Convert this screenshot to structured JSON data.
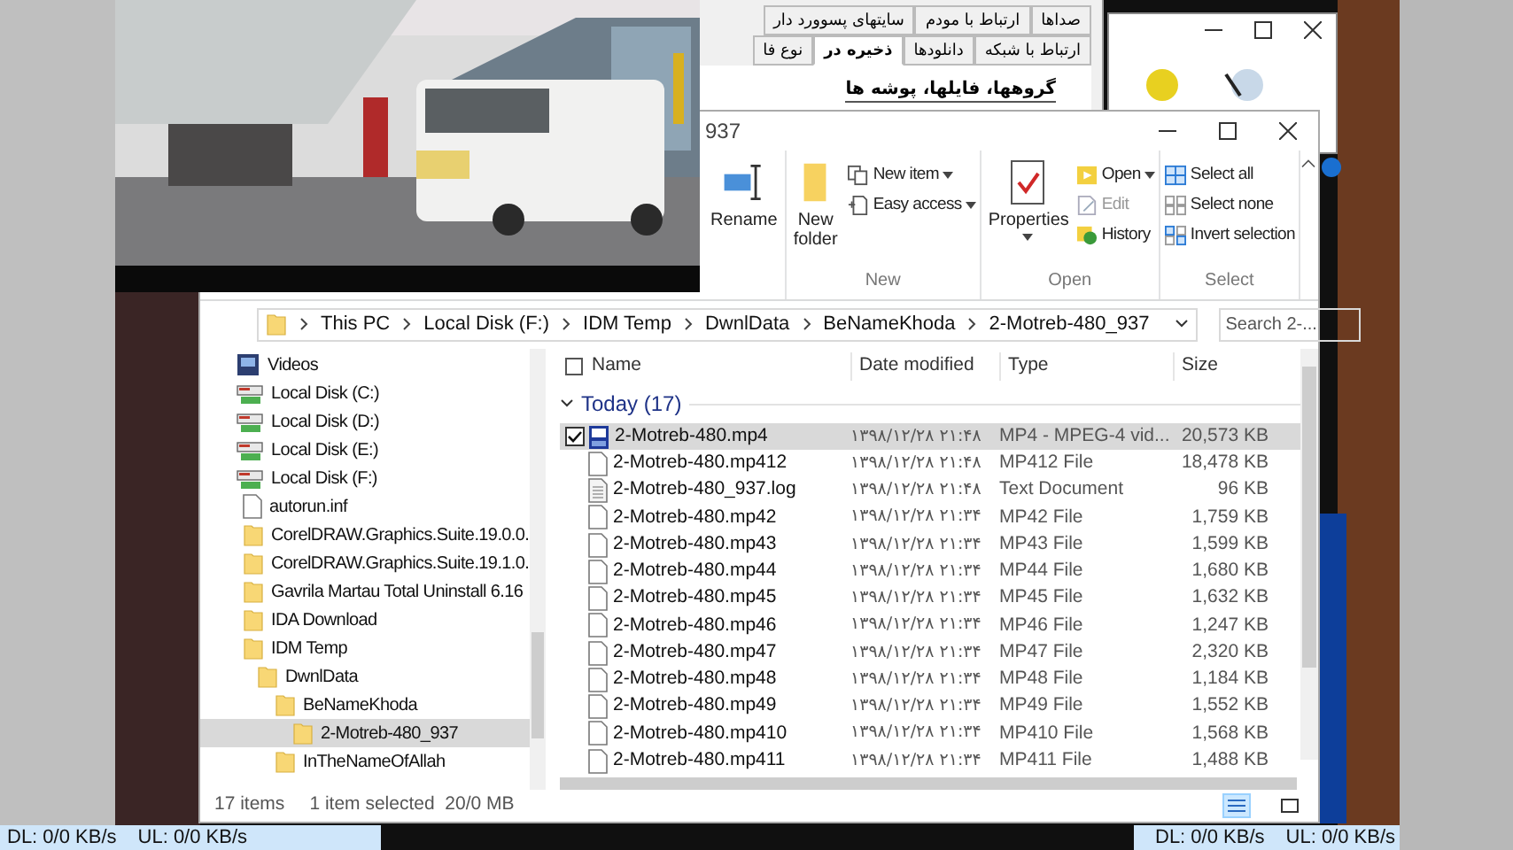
{
  "back_dialog": {
    "tabs_top": [
      {
        "label": "صداها",
        "selected": false
      },
      {
        "label": "ارتباط با مودم",
        "selected": false
      },
      {
        "label": "سایتهای پسوورد دار",
        "selected": false
      }
    ],
    "tabs_bottom": [
      {
        "label": "ارتباط با شبکه",
        "selected": false
      },
      {
        "label": "دانلودها",
        "selected": false
      },
      {
        "label": "ذخیره در",
        "selected": true
      },
      {
        "label": "نوع فا",
        "selected": false
      }
    ],
    "heading": "گروهها، فایلها، پوشه ها"
  },
  "explorer": {
    "title": "937",
    "ribbon": {
      "groups": [
        {
          "items": [
            {
              "label": "Rename",
              "kind": "large"
            }
          ]
        },
        {
          "label": "New",
          "items": [
            {
              "label": "New folder",
              "kind": "large"
            },
            {
              "label": "New item",
              "kind": "small",
              "dropdown": true
            },
            {
              "label": "Easy access",
              "kind": "small",
              "dropdown": true
            }
          ]
        },
        {
          "label": "Open",
          "items": [
            {
              "label": "Properties",
              "kind": "large",
              "dropdown": true
            },
            {
              "label": "Open",
              "kind": "small",
              "dropdown": true
            },
            {
              "label": "Edit",
              "kind": "small",
              "disabled": true
            },
            {
              "label": "History",
              "kind": "small"
            }
          ]
        },
        {
          "label": "Select",
          "items": [
            {
              "label": "Select all",
              "kind": "small"
            },
            {
              "label": "Select none",
              "kind": "small"
            },
            {
              "label": "Invert selection",
              "kind": "small"
            }
          ]
        }
      ]
    },
    "breadcrumb": [
      "This PC",
      "Local Disk (F:)",
      "IDM Temp",
      "DwnlData",
      "BeNameKhoda",
      "2-Motreb-480_937"
    ],
    "search": {
      "placeholder": "Search 2-..."
    },
    "nav": [
      {
        "label": "Videos",
        "kind": "videos",
        "selected": false
      },
      {
        "label": "Local Disk (C:)",
        "kind": "drive",
        "selected": false
      },
      {
        "label": "Local Disk (D:)",
        "kind": "drive",
        "selected": false
      },
      {
        "label": "Local Disk (E:)",
        "kind": "drive",
        "selected": false
      },
      {
        "label": "Local Disk (F:)",
        "kind": "drive",
        "selected": false,
        "children": [
          {
            "label": "autorun.inf",
            "kind": "file",
            "selected": false
          },
          {
            "label": "CorelDRAW.Graphics.Suite.19.0.0.",
            "kind": "folder",
            "selected": false
          },
          {
            "label": "CorelDRAW.Graphics.Suite.19.1.0.",
            "kind": "folder",
            "selected": false
          },
          {
            "label": "Gavrila Martau Total Uninstall 6.16",
            "kind": "folder",
            "selected": false
          },
          {
            "label": "IDA Download",
            "kind": "folder",
            "selected": false
          },
          {
            "label": "IDM Temp",
            "kind": "folder",
            "selected": false,
            "children": [
              {
                "label": "DwnlData",
                "kind": "folder",
                "selected": false,
                "children": [
                  {
                    "label": "BeNameKhoda",
                    "kind": "folder",
                    "selected": false,
                    "children": [
                      {
                        "label": "2-Motreb-480_937",
                        "kind": "folder",
                        "selected": true
                      }
                    ]
                  },
                  {
                    "label": "InTheNameOfAllah",
                    "kind": "folder",
                    "selected": false
                  }
                ]
              }
            ]
          }
        ]
      }
    ],
    "columns": [
      "Name",
      "Date modified",
      "Type",
      "Size"
    ],
    "group": "Today (17)",
    "files": [
      {
        "name": "2-Motreb-480.mp4",
        "date": "۱۳۹۸/۱۲/۲۸ ۲۱:۴۸",
        "type": "MP4 - MPEG-4 vid...",
        "size": "20,573 KB",
        "kind": "video",
        "selected": true
      },
      {
        "name": "2-Motreb-480.mp412",
        "date": "۱۳۹۸/۱۲/۲۸ ۲۱:۴۸",
        "type": "MP412 File",
        "size": "18,478 KB",
        "kind": "file",
        "selected": false
      },
      {
        "name": "2-Motreb-480_937.log",
        "date": "۱۳۹۸/۱۲/۲۸ ۲۱:۴۸",
        "type": "Text Document",
        "size": "96 KB",
        "kind": "text",
        "selected": false
      },
      {
        "name": "2-Motreb-480.mp42",
        "date": "۱۳۹۸/۱۲/۲۸ ۲۱:۳۴",
        "type": "MP42 File",
        "size": "1,759 KB",
        "kind": "file",
        "selected": false
      },
      {
        "name": "2-Motreb-480.mp43",
        "date": "۱۳۹۸/۱۲/۲۸ ۲۱:۳۴",
        "type": "MP43 File",
        "size": "1,599 KB",
        "kind": "file",
        "selected": false
      },
      {
        "name": "2-Motreb-480.mp44",
        "date": "۱۳۹۸/۱۲/۲۸ ۲۱:۳۴",
        "type": "MP44 File",
        "size": "1,680 KB",
        "kind": "file",
        "selected": false
      },
      {
        "name": "2-Motreb-480.mp45",
        "date": "۱۳۹۸/۱۲/۲۸ ۲۱:۳۴",
        "type": "MP45 File",
        "size": "1,632 KB",
        "kind": "file",
        "selected": false
      },
      {
        "name": "2-Motreb-480.mp46",
        "date": "۱۳۹۸/۱۲/۲۸ ۲۱:۳۴",
        "type": "MP46 File",
        "size": "1,247 KB",
        "kind": "file",
        "selected": false
      },
      {
        "name": "2-Motreb-480.mp47",
        "date": "۱۳۹۸/۱۲/۲۸ ۲۱:۳۴",
        "type": "MP47 File",
        "size": "2,320 KB",
        "kind": "file",
        "selected": false
      },
      {
        "name": "2-Motreb-480.mp48",
        "date": "۱۳۹۸/۱۲/۲۸ ۲۱:۳۴",
        "type": "MP48 File",
        "size": "1,184 KB",
        "kind": "file",
        "selected": false
      },
      {
        "name": "2-Motreb-480.mp49",
        "date": "۱۳۹۸/۱۲/۲۸ ۲۱:۳۴",
        "type": "MP49 File",
        "size": "1,552 KB",
        "kind": "file",
        "selected": false
      },
      {
        "name": "2-Motreb-480.mp410",
        "date": "۱۳۹۸/۱۲/۲۸ ۲۱:۳۴",
        "type": "MP410 File",
        "size": "1,568 KB",
        "kind": "file",
        "selected": false
      },
      {
        "name": "2-Motreb-480.mp411",
        "date": "۱۳۹۸/۱۲/۲۸ ۲۱:۳۴",
        "type": "MP411 File",
        "size": "1,488 KB",
        "kind": "file",
        "selected": false
      }
    ],
    "status": {
      "count": "17 items",
      "selection": "1 item selected  20/0 MB"
    },
    "views": [
      {
        "kind": "details",
        "selected": true
      },
      {
        "kind": "large-icons",
        "selected": false
      }
    ]
  },
  "speed_bars": [
    {
      "dl": "DL: 0/0 KB/s",
      "ul": "UL: 0/0 KB/s"
    },
    {
      "dl": "DL: 0/0 KB/s",
      "ul": "UL: 0/0 KB/s"
    }
  ]
}
